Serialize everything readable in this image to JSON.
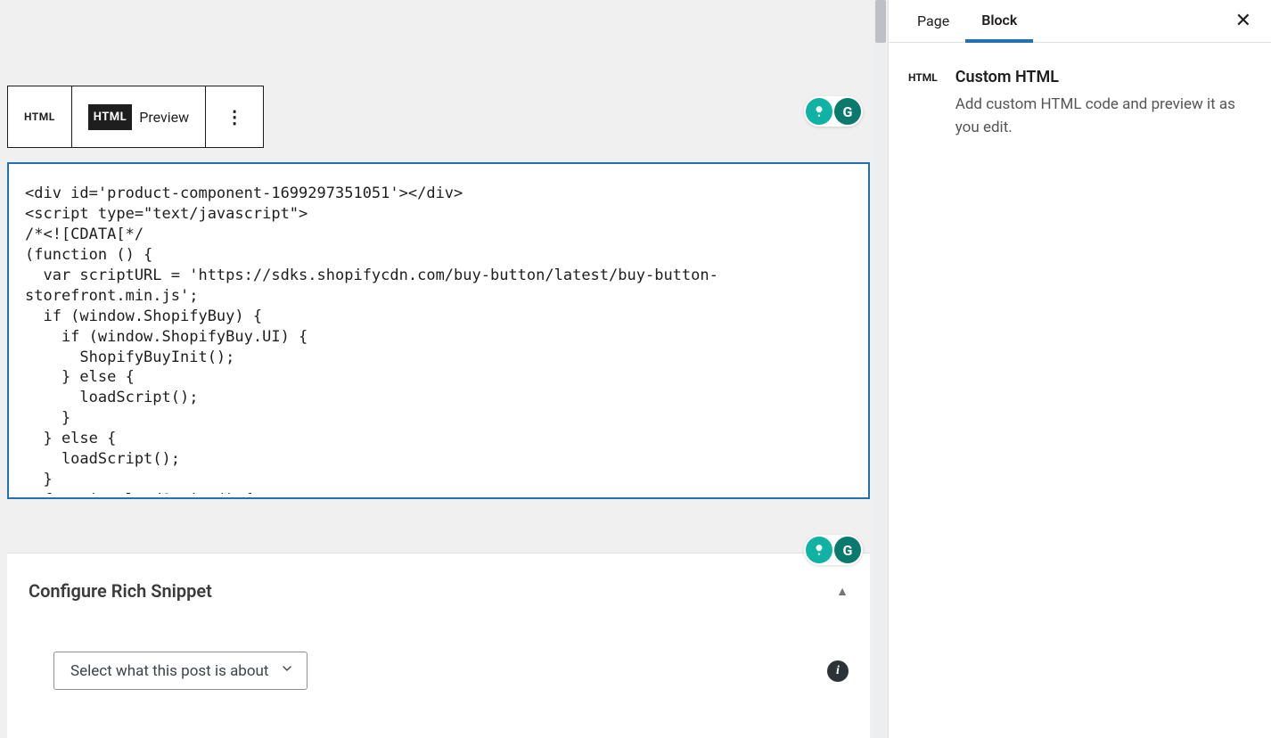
{
  "toolbar": {
    "html_icon_label": "HTML",
    "html_badge": "HTML",
    "preview_label": "Preview",
    "more_label": "⋮"
  },
  "code_block": {
    "content": "<div id='product-component-1699297351051'></div>\n<script type=\"text/javascript\">\n/*<![CDATA[*/\n(function () {\n  var scriptURL = 'https://sdks.shopifycdn.com/buy-button/latest/buy-button-\nstorefront.min.js';\n  if (window.ShopifyBuy) {\n    if (window.ShopifyBuy.UI) {\n      ShopifyBuyInit();\n    } else {\n      loadScript();\n    }\n  } else {\n    loadScript();\n  }\n  function loadScript() {"
  },
  "badges": {
    "grammarly_letter": "G"
  },
  "snippet": {
    "title": "Configure Rich Snippet",
    "caret": "▲",
    "select_label": "Select what this post is about",
    "select_caret": "⌄",
    "info_label": "i"
  },
  "sidebar": {
    "tabs": {
      "page": "Page",
      "block": "Block"
    },
    "close": "✕",
    "html_icon": "HTML",
    "title": "Custom HTML",
    "description": "Add custom HTML code and preview it as you edit."
  }
}
